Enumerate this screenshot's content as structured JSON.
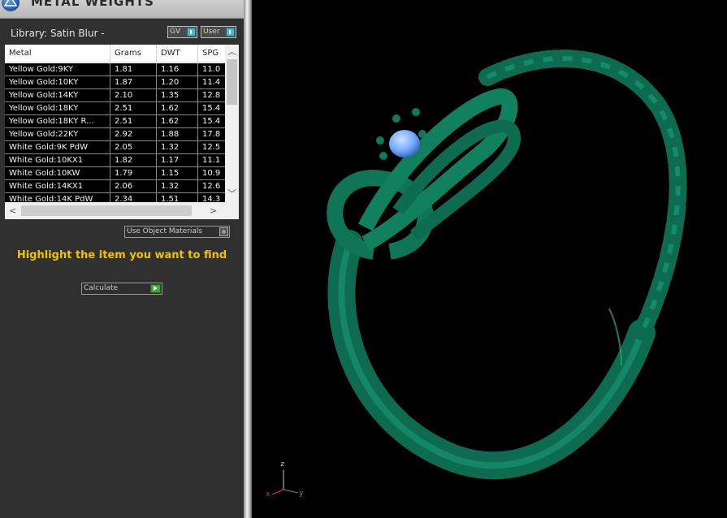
{
  "titlebar": {
    "title": "METAL WEIGHTS"
  },
  "library": {
    "label": "Library: Satin Blur -",
    "gv_label": "GV",
    "user_label": "User"
  },
  "table": {
    "headers": [
      "Metal",
      "Grams",
      "DWT",
      "SPG"
    ],
    "rows": [
      [
        "Yellow Gold:9KY",
        "1.81",
        "1.16",
        "11.0"
      ],
      [
        "Yellow Gold:10KY",
        "1.87",
        "1.20",
        "11.4"
      ],
      [
        "Yellow Gold:14KY",
        "2.10",
        "1.35",
        "12.8"
      ],
      [
        "Yellow Gold:18KY",
        "2.51",
        "1.62",
        "15.4"
      ],
      [
        "Yellow Gold:18KY R...",
        "2.51",
        "1.62",
        "15.4"
      ],
      [
        "Yellow Gold:22KY",
        "2.92",
        "1.88",
        "17.8"
      ],
      [
        "White Gold:9K PdW",
        "2.05",
        "1.32",
        "12.5"
      ],
      [
        "White Gold:10KX1",
        "1.82",
        "1.17",
        "11.1"
      ],
      [
        "White Gold:10KW",
        "1.79",
        "1.15",
        "10.9"
      ],
      [
        "White Gold:14KX1",
        "2.06",
        "1.32",
        "12.6"
      ],
      [
        "White Gold:14K PdW",
        "2.34",
        "1.51",
        "14.3"
      ]
    ]
  },
  "options": {
    "use_object_materials": "Use Object Materials",
    "calculate": "Calculate"
  },
  "message": "Highlight the item you want to find",
  "axes": {
    "z": "z",
    "x": "x",
    "y": "y"
  },
  "colors": {
    "ring": "#0f7a5a",
    "stone": "#6fa8ff",
    "highlight_text": "#f2c200",
    "panel_bg": "#303030"
  }
}
